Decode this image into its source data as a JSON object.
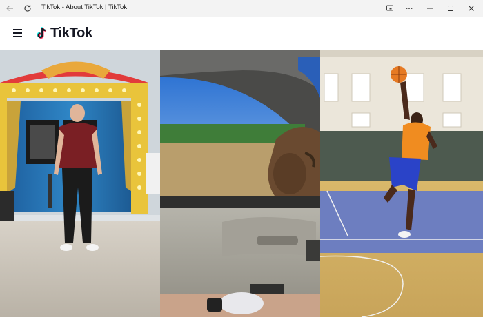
{
  "window": {
    "title": "TikTok - About TikTok | TikTok",
    "icons": [
      "back-arrow-icon",
      "refresh-icon",
      "cast-icon",
      "more-icon",
      "minimize-icon",
      "maximize-icon",
      "close-icon"
    ]
  },
  "header": {
    "logo_text": "TikTok",
    "menu_icon": "hamburger-menu-icon"
  },
  "showcase": {
    "panels": [
      {
        "subject": "man-standing-on-stage"
      },
      {
        "subject": "bison-at-car-window"
      },
      {
        "subject": "basketball-player-dunking"
      }
    ]
  },
  "colors": {
    "titlebar": "#f3f3f3",
    "logo_text": "#161823",
    "logo_cyan": "#25f4ee",
    "logo_pink": "#fe2c55"
  }
}
